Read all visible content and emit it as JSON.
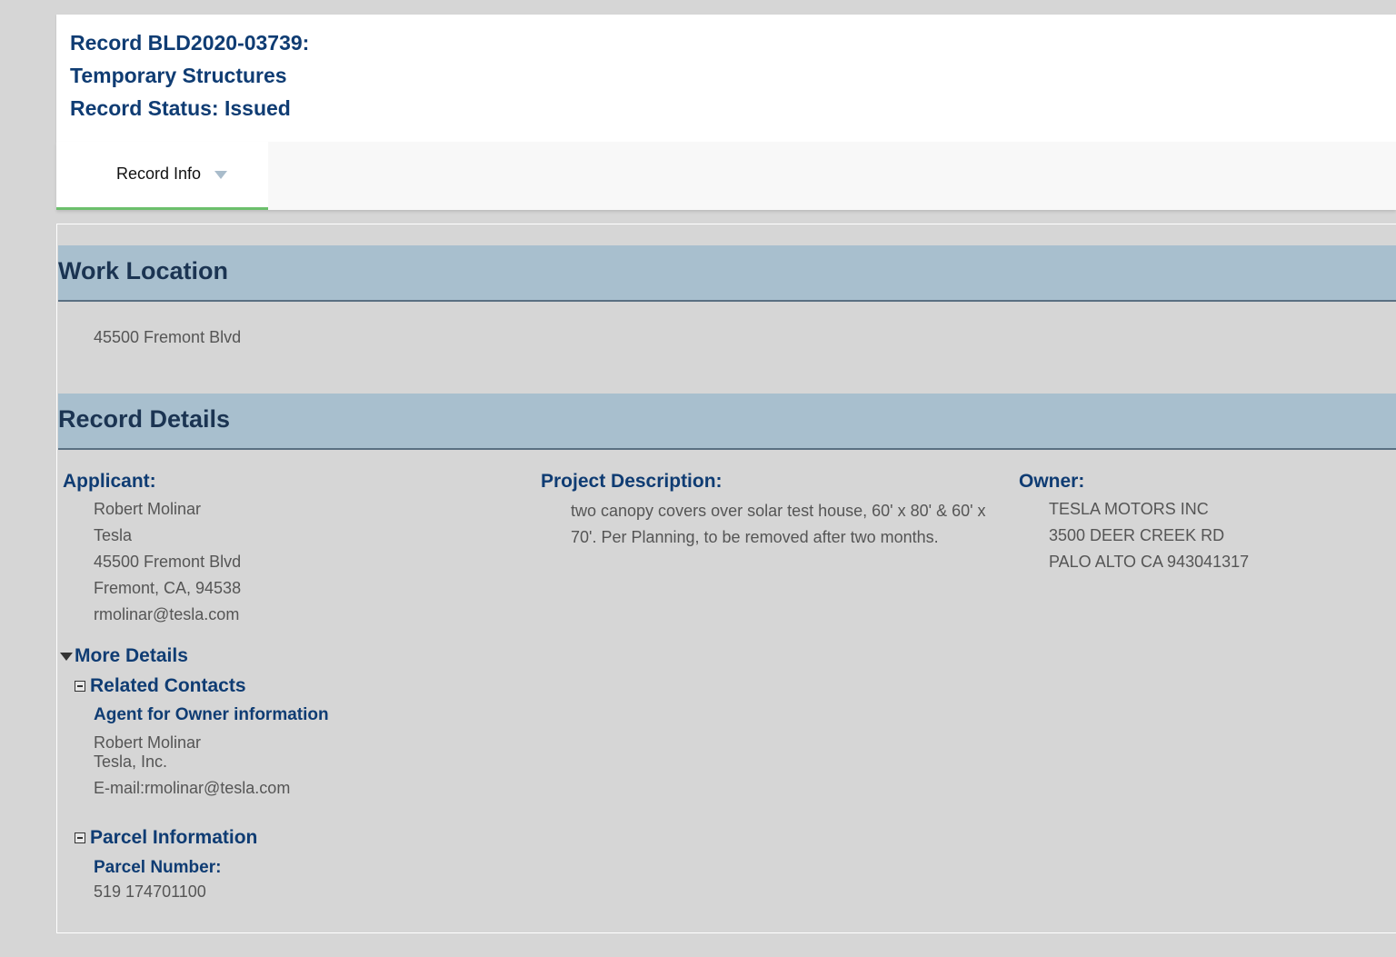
{
  "header": {
    "record_line": "Record BLD2020-03739:",
    "type_line": "Temporary Structures",
    "status_line": "Record Status: Issued"
  },
  "tabs": {
    "record_info": "Record Info"
  },
  "work_location": {
    "title": "Work Location",
    "address": "45500 Fremont Blvd"
  },
  "record_details": {
    "title": "Record Details",
    "applicant": {
      "label": "Applicant:",
      "name": "Robert Molinar",
      "company": "Tesla",
      "street": "45500 Fremont Blvd",
      "city": "Fremont, CA, 94538",
      "email": "rmolinar@tesla.com"
    },
    "project_description": {
      "label": "Project Description:",
      "text": "two canopy covers over solar test house, 60' x 80' & 60' x 70'. Per Planning, to be removed after two months."
    },
    "owner": {
      "label": "Owner:",
      "name": "TESLA MOTORS INC",
      "street": "3500 DEER CREEK RD",
      "city": "PALO ALTO CA 943041317"
    }
  },
  "more_details": {
    "label": "More Details",
    "related_contacts": {
      "label": "Related Contacts",
      "agent_heading": "Agent for Owner information",
      "name": "Robert Molinar",
      "company": "Tesla, Inc.",
      "email": "E-mail:rmolinar@tesla.com"
    },
    "parcel_information": {
      "label": "Parcel Information",
      "number_label": "Parcel Number:",
      "number": "519 174701100"
    }
  },
  "colors": {
    "heading_blue": "#0f3c73",
    "section_bar": "#a8bfce",
    "tab_underline": "#6cbf6c",
    "page_background": "#d6d6d6"
  }
}
